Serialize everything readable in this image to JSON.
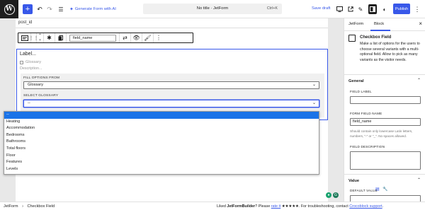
{
  "topbar": {
    "generate_ai": "Generate Form with AI",
    "doc_title": "No title · JetForm",
    "shortcut": "Ctrl+K",
    "save_draft": "Save draft",
    "publish": "Publish"
  },
  "canvas": {
    "post_id": "post_id",
    "toolbar_field_value": "field_name",
    "field_label": "Label...",
    "checkbox_option": "Glossary",
    "description_placeholder": "Description...",
    "fill_options_label": "FILL OPTIONS FROM",
    "fill_options_value": "Glossary",
    "select_glossary_label": "SELECT GLOSSARY",
    "select_glossary_value": "--"
  },
  "dropdown": {
    "items": [
      "--",
      "Heating",
      "Accommodation",
      "Bedrooms",
      "Bathrooms",
      "Total floors",
      "Floor",
      "Features",
      "Levels"
    ],
    "selected_index": 0
  },
  "sidebar": {
    "tabs": [
      "JetForm",
      "Block"
    ],
    "active_tab": "Block",
    "block_name": "Checkbox Field",
    "block_description": "Make a list of options for the users to choose several variants with a multi-optional field. Allow to pick as many variants as the visitor needs.",
    "general_heading": "General",
    "field_label_label": "FIELD LABEL",
    "field_label_value": "",
    "form_field_name_label": "FORM FIELD NAME",
    "form_field_name_value": "field_name",
    "field_name_help": "Should contain only lowercase Latin letters, numbers, \"-\" or \"_\". No spaces allowed.",
    "field_description_label": "FIELD DESCRIPTION",
    "field_description_value": "",
    "value_heading": "Value",
    "default_value_label": "DEFAULT VALUE"
  },
  "footer": {
    "breadcrumb_root": "JetForm",
    "breadcrumb_sep": "›",
    "breadcrumb_current": "Checkbox Field",
    "rate_prefix": "Liked ",
    "rate_brand": "JetFormBuilder",
    "rate_mid": "? Please ",
    "rate_link": "rate it",
    "rate_stars": "★★★★★",
    "rate_suffix": ". For troubleshooting, contact ",
    "support_link": "Crocoblock support",
    "rate_end": "."
  },
  "colors": {
    "accent": "#3858e9",
    "dropdown_highlight": "#1a73e8"
  }
}
